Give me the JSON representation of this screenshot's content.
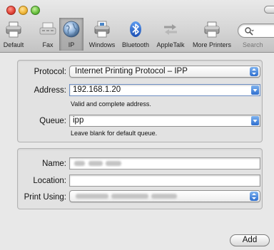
{
  "toolbar": {
    "items": [
      {
        "label": "Default",
        "icon": "printer-icon"
      },
      {
        "label": "Fax",
        "icon": "fax-icon"
      },
      {
        "label": "IP",
        "icon": "globe-icon"
      },
      {
        "label": "Windows",
        "icon": "windows-printer-icon"
      },
      {
        "label": "Bluetooth",
        "icon": "bluetooth-icon"
      },
      {
        "label": "AppleTalk",
        "icon": "appletalk-icon"
      },
      {
        "label": "More Printers",
        "icon": "printer-icon"
      }
    ],
    "selected": "IP",
    "search_label": "Search"
  },
  "protocol": {
    "label": "Protocol:",
    "value": "Internet Printing Protocol – IPP"
  },
  "address": {
    "label": "Address:",
    "value": "192.168.1.20",
    "hint": "Valid and complete address."
  },
  "queue": {
    "label": "Queue:",
    "value": "ipp",
    "hint": "Leave blank for default queue."
  },
  "name": {
    "label": "Name:",
    "value": ""
  },
  "location": {
    "label": "Location:",
    "value": ""
  },
  "print_using": {
    "label": "Print Using:",
    "value": ""
  },
  "add_button": {
    "label": "Add"
  },
  "colors": {
    "accent_blue": "#2f6fcf",
    "close": "#e3463a",
    "minimize": "#f0b73a",
    "zoom": "#6cc341"
  }
}
